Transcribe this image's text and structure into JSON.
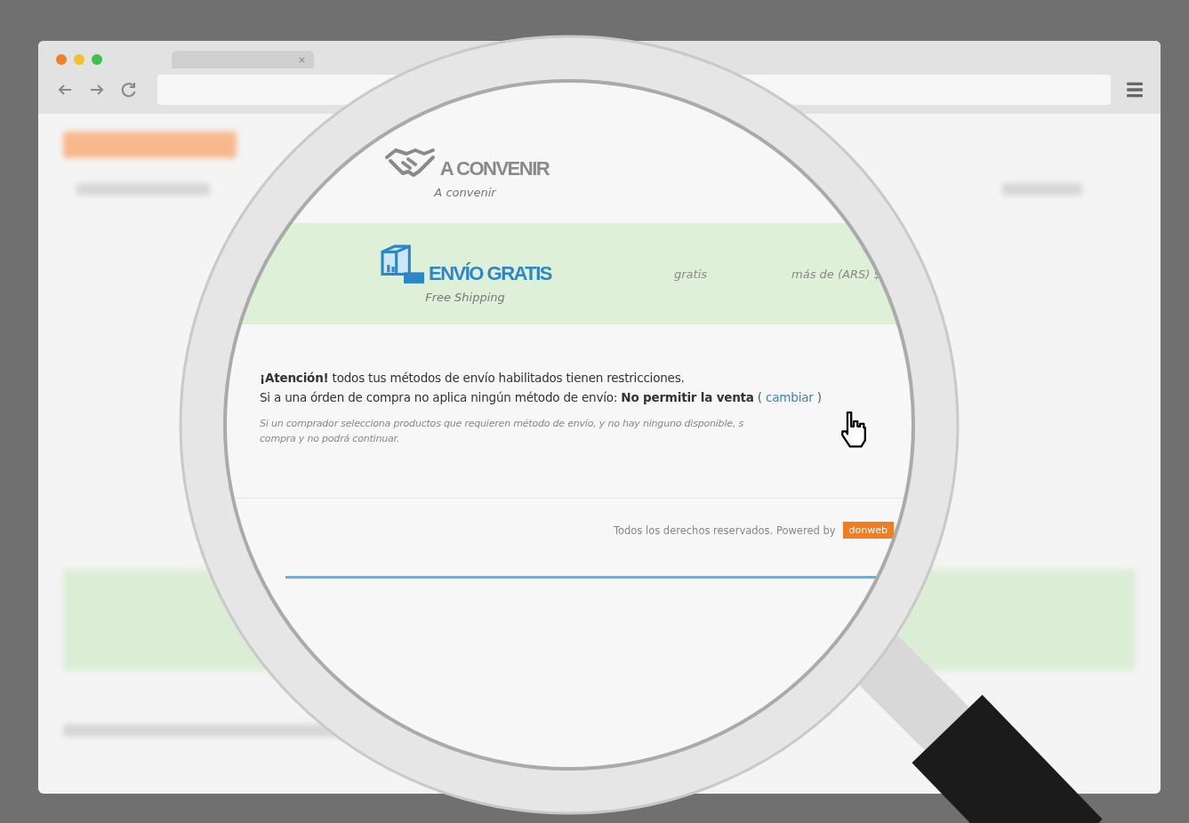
{
  "shipping_methods": [
    {
      "kind": "negotiable",
      "title": "A CONVENIR",
      "subtitle": "A convenir",
      "highlighted": false
    },
    {
      "kind": "free",
      "title": "ENVÍO GRATIS",
      "subtitle": "Free Shipping",
      "highlighted": true,
      "cost": "gratis",
      "condition": "más de (ARS) $"
    }
  ],
  "notice": {
    "line1": "**¡Atención!** todos tus métodos de envío habilitados tienen restricciones.",
    "line2": "Si a una órden de compra no aplica ningún método de envío: **No permitir la venta**",
    "link_open": "(",
    "link": "cambiar",
    "link_close": ")",
    "note": [
      "Si un comprador selecciona productos que requieren método de envío, y no hay ninguno disponible, s",
      "compra y no podrá continuar."
    ]
  },
  "footer": {
    "text": "Todos los derechos reservados. Powered by",
    "badge": "donweb"
  }
}
